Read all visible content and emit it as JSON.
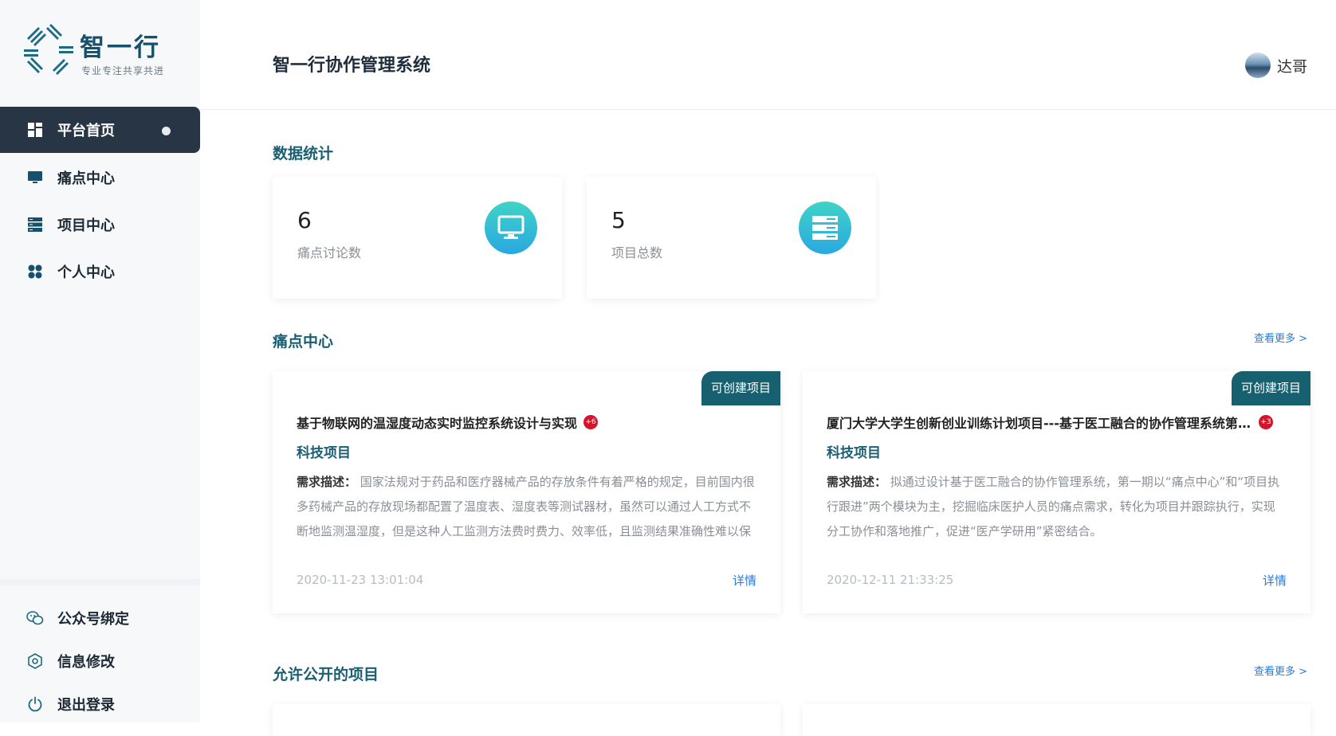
{
  "brand": {
    "name": "智一行",
    "slogan": "专业专注共享共进"
  },
  "sidebar": {
    "items": [
      {
        "label": "平台首页",
        "icon": "dashboard-icon",
        "active": true
      },
      {
        "label": "痛点中心",
        "icon": "monitor-icon"
      },
      {
        "label": "项目中心",
        "icon": "server-list-icon"
      },
      {
        "label": "个人中心",
        "icon": "grid-blocks-icon"
      }
    ],
    "bottom": [
      {
        "label": "公众号绑定",
        "icon": "wechat-icon"
      },
      {
        "label": "信息修改",
        "icon": "settings-icon"
      },
      {
        "label": "退出登录",
        "icon": "power-icon"
      }
    ]
  },
  "header": {
    "title": "智一行协作管理系统",
    "user_name": "达哥"
  },
  "stats": {
    "section_title": "数据统计",
    "cards": [
      {
        "value": "6",
        "label": "痛点讨论数",
        "icon": "monitor-icon"
      },
      {
        "value": "5",
        "label": "项目总数",
        "icon": "server-list-icon"
      }
    ]
  },
  "pain_center": {
    "section_title": "痛点中心",
    "more": "查看更多 >",
    "cards": [
      {
        "tag": "可创建项目",
        "title": "基于物联网的温湿度动态实时监控系统设计与实现",
        "badge": "+6",
        "category": "科技项目",
        "desc_label": "需求描述：",
        "desc": "国家法规对于药品和医疗器械产品的存放条件有着严格的规定，目前国内很多药械产品的存放现场都配置了温度表、湿度表等测试器材，虽然可以通过人工方式不断地监测温湿度，但是这种人工监测方法费时费力、效率低，且监测结果准确性难以保证。",
        "time": "2020-11-23 13:01:04",
        "detail": "详情"
      },
      {
        "tag": "可创建项目",
        "title": "厦门大学大学生创新创业训练计划项目---基于医工融合的协作管理系统第一期",
        "badge": "+3",
        "category": "科技项目",
        "desc_label": "需求描述：",
        "desc": "拟通过设计基于医工融合的协作管理系统，第一期以“痛点中心”和“项目执行跟进”两个模块为主，挖掘临床医护人员的痛点需求，转化为项目并跟踪执行，实现分工协作和落地推广，促进“医产学研用”紧密结合。",
        "time": "2020-12-11 21:33:25",
        "detail": "详情"
      }
    ]
  },
  "public_projects": {
    "section_title": "允许公开的项目",
    "more": "查看更多 >"
  },
  "colors": {
    "sidebar_active": "#273545",
    "accent_teal": "#1a5e74",
    "tag_bg": "#17606f",
    "link": "#2b7bd0",
    "badge": "#d3142a"
  }
}
